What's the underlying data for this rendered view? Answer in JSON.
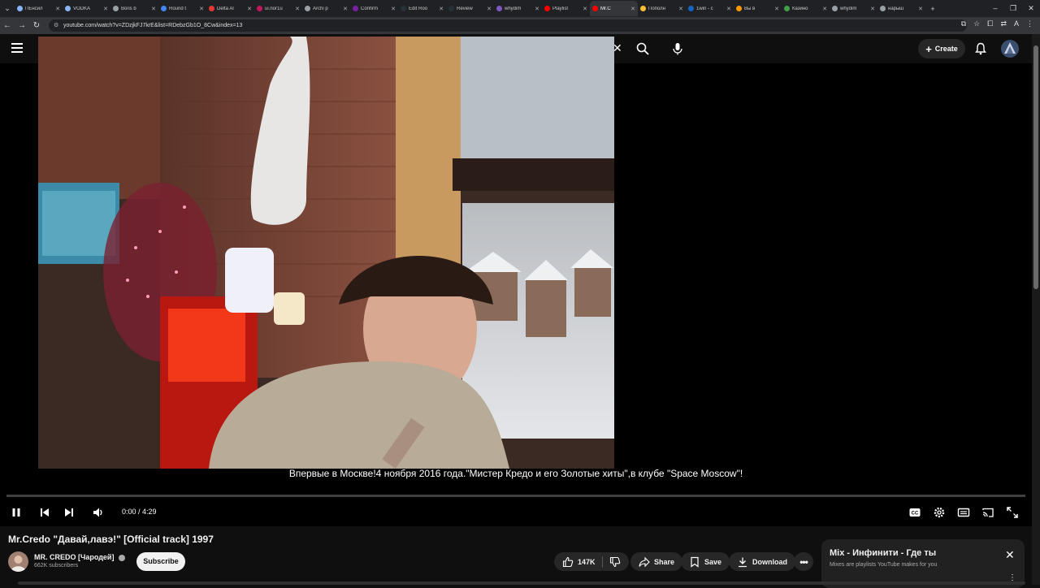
{
  "browser": {
    "tabs": [
      {
        "label": "ПЕнсил",
        "color": "#8ab4f8"
      },
      {
        "label": "VODKA",
        "color": "#8ab4f8"
      },
      {
        "label": "Boris b",
        "color": "#9aa0a6"
      },
      {
        "label": "Round t",
        "color": "#4285f4"
      },
      {
        "label": "Delta Al",
        "color": "#e53935"
      },
      {
        "label": "ui.nor1u",
        "color": "#c2185b"
      },
      {
        "label": "Archi p",
        "color": "#9aa0a6"
      },
      {
        "label": "Confirm",
        "color": "#7b1fa2"
      },
      {
        "label": "Edit Roo",
        "color": "#263238"
      },
      {
        "label": "Review",
        "color": "#263238"
      },
      {
        "label": "whydim",
        "color": "#7e57c2"
      },
      {
        "label": "Playlist",
        "color": "#ff0000"
      },
      {
        "label": "Mr.C",
        "color": "#ff0000"
      },
      {
        "label": "Пополн",
        "color": "#fbc02d"
      },
      {
        "label": "1win - c",
        "color": "#1565c0"
      },
      {
        "label": "Вы в",
        "color": "#ff9800"
      },
      {
        "label": "Казино",
        "color": "#43a047"
      },
      {
        "label": "whydim",
        "color": "#9aa0a6"
      },
      {
        "label": "нарыш",
        "color": "#9aa0a6"
      }
    ],
    "active_tab_index": 12,
    "url": "youtube.com/watch?v=ZDzjkFJ7krE&list=RDebzGb1O_8Cw&index=13"
  },
  "youtube": {
    "create_label": "Create"
  },
  "player": {
    "subtitle": "Впервые в Москве!4 ноября 2016 года.\"Мистер Кредо и его Золотые хиты\",в клубе \"Space Moscow\"!",
    "time": "0:00 / 4:29",
    "progress": 0
  },
  "video_info": {
    "title": "Mr.Credo \"Давай,лавэ!\" [Official track] 1997",
    "channel_name": "MR. CREDO [Чародей]",
    "subscribers": "662K subscribers",
    "subscribe_label": "Subscribe",
    "likes": "147K",
    "share_label": "Share",
    "save_label": "Save",
    "download_label": "Download"
  },
  "mix": {
    "title": "Mix - Инфинити - Где ты",
    "subtitle": "Mixes are playlists YouTube makes for you"
  }
}
